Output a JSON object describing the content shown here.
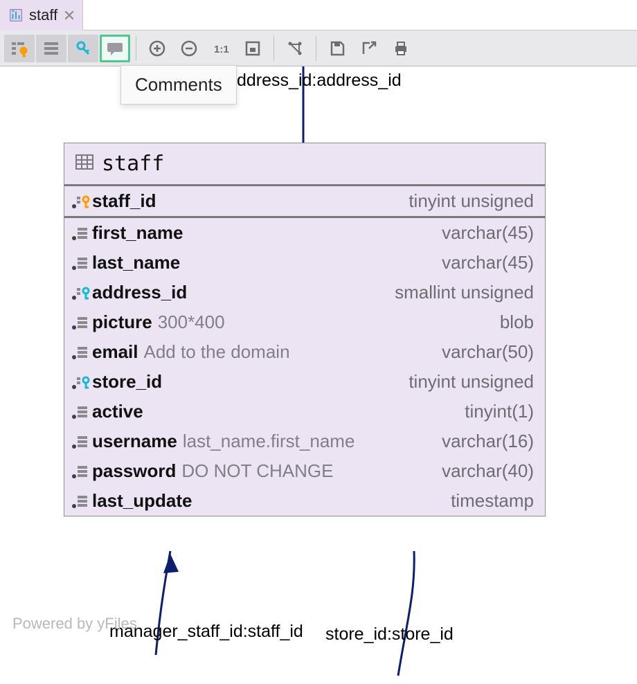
{
  "tab": {
    "label": "staff"
  },
  "tooltip": "Comments",
  "relations": {
    "top": "ddress_id:address_id",
    "bl": "manager_staff_id:staff_id",
    "br": "store_id:store_id"
  },
  "powered": "Powered by yFiles",
  "table": {
    "name": "staff",
    "columns": [
      {
        "name": "staff_id",
        "type": "tinyint unsigned",
        "kind": "pk",
        "comment": ""
      },
      {
        "name": "first_name",
        "type": "varchar(45)",
        "kind": "col",
        "comment": ""
      },
      {
        "name": "last_name",
        "type": "varchar(45)",
        "kind": "col",
        "comment": ""
      },
      {
        "name": "address_id",
        "type": "smallint unsigned",
        "kind": "fk",
        "comment": ""
      },
      {
        "name": "picture",
        "type": "blob",
        "kind": "col",
        "comment": "300*400"
      },
      {
        "name": "email",
        "type": "varchar(50)",
        "kind": "col",
        "comment": "Add to the domain"
      },
      {
        "name": "store_id",
        "type": "tinyint unsigned",
        "kind": "fk",
        "comment": ""
      },
      {
        "name": "active",
        "type": "tinyint(1)",
        "kind": "col",
        "comment": ""
      },
      {
        "name": "username",
        "type": "varchar(16)",
        "kind": "col",
        "comment": "last_name.first_name"
      },
      {
        "name": "password",
        "type": "varchar(40)",
        "kind": "col",
        "comment": "DO NOT CHANGE"
      },
      {
        "name": "last_update",
        "type": "timestamp",
        "kind": "col",
        "comment": ""
      }
    ]
  }
}
